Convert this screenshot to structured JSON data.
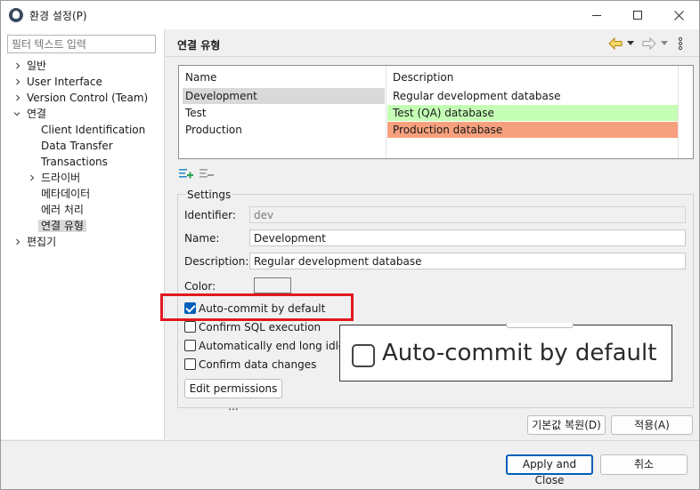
{
  "window": {
    "title": "환경 설정(P)",
    "minimize_icon": "minimize-icon",
    "maximize_icon": "maximize-icon",
    "close_icon": "close-icon"
  },
  "left_panel": {
    "filter_placeholder": "필터 텍스트 입력",
    "tree": [
      {
        "label": "일반",
        "expandable": true,
        "expanded": false
      },
      {
        "label": "User Interface",
        "expandable": true,
        "expanded": false
      },
      {
        "label": "Version Control (Team)",
        "expandable": true,
        "expanded": false
      },
      {
        "label": "연결",
        "expandable": true,
        "expanded": true
      },
      {
        "label": "Client Identification",
        "expandable": false
      },
      {
        "label": "Data Transfer",
        "expandable": false
      },
      {
        "label": "Transactions",
        "expandable": false
      },
      {
        "label": "드라이버",
        "expandable": true,
        "expanded": false
      },
      {
        "label": "메타데이터",
        "expandable": false
      },
      {
        "label": "에러 처리",
        "expandable": false
      },
      {
        "label": "연결 유형",
        "expandable": false,
        "selected": true
      },
      {
        "label": "편집기",
        "expandable": true,
        "expanded": false
      }
    ]
  },
  "page": {
    "title": "연결 유형",
    "nav_icons": [
      "back-arrow-icon",
      "dropdown-icon",
      "forward-arrow-icon",
      "dropdown-icon",
      "more-vertical-icon"
    ]
  },
  "types_table": {
    "columns": [
      "Name",
      "Description"
    ],
    "rows": [
      {
        "name": "Development",
        "description": "Regular development database",
        "color": "#ffffff",
        "selected": true
      },
      {
        "name": "Test",
        "description": "Test (QA) database",
        "color": "#c4ffb5"
      },
      {
        "name": "Production",
        "description": "Production database",
        "color": "#f7a07e"
      }
    ]
  },
  "table_toolbar": {
    "add_icon": "add-row-icon",
    "remove_icon": "remove-row-icon"
  },
  "settings": {
    "legend": "Settings",
    "identifier_label": "Identifier:",
    "identifier_value": "dev",
    "name_label": "Name:",
    "name_value": "Development",
    "description_label": "Description:",
    "description_value": "Regular development database",
    "color_label": "Color:",
    "checkboxes": [
      {
        "label": "Auto-commit by default",
        "checked": true
      },
      {
        "label": "Confirm SQL execution",
        "checked": false
      },
      {
        "label": "Automatically end long idle t",
        "checked": false
      },
      {
        "label": "Confirm data changes",
        "checked": false
      }
    ],
    "edit_permissions_label": "Edit permissions ..."
  },
  "zoom_callout": {
    "label": "Auto-commit by default"
  },
  "page_buttons": {
    "restore_defaults": "기본값 복원(D)",
    "apply": "적용(A)"
  },
  "dialog_buttons": {
    "apply_and_close": "Apply and Close",
    "cancel": "취소"
  },
  "colors": {
    "accent": "#005fb8",
    "highlight_box": "#e0191f",
    "test_row": "#c4ffb5",
    "production_row": "#f7a07e",
    "selection": "#d9d9d9"
  }
}
